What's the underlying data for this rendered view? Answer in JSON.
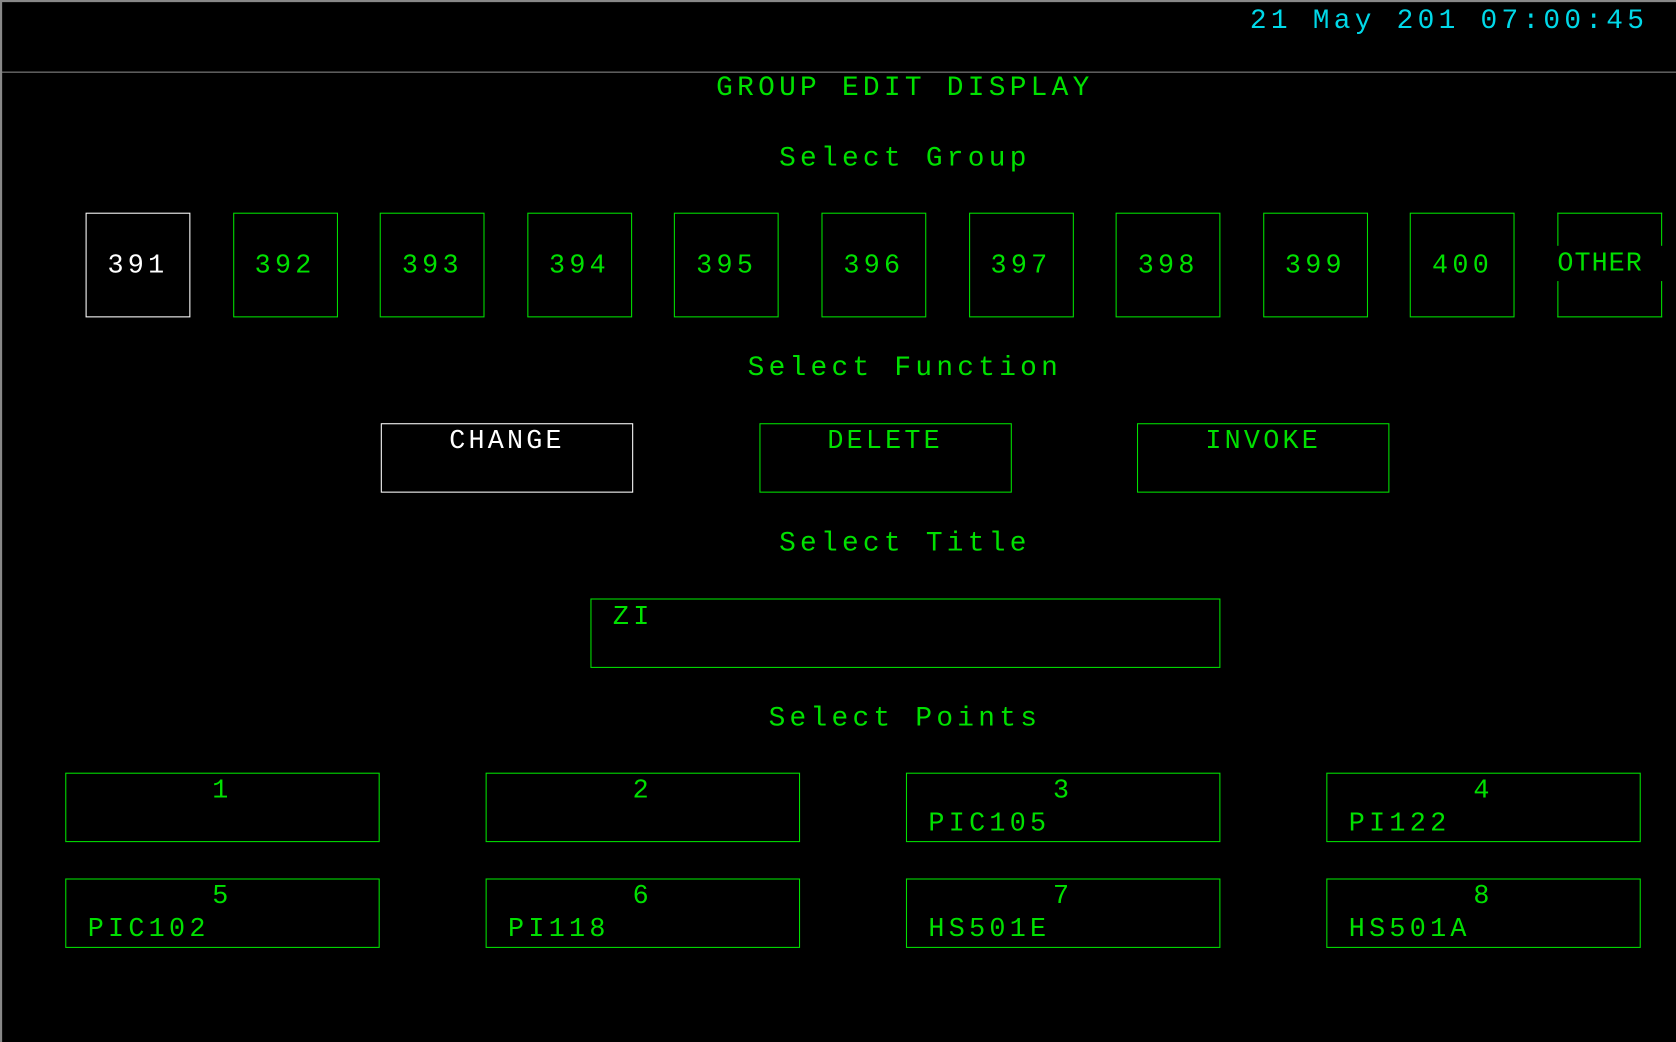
{
  "header": {
    "date": "21 May 201",
    "time": "07:00:45"
  },
  "title": "GROUP EDIT DISPLAY",
  "select_group": {
    "label": "Select Group",
    "groups": [
      "391",
      "392",
      "393",
      "394",
      "395",
      "396",
      "397",
      "398",
      "399",
      "400",
      "OTHER"
    ],
    "selected": "391"
  },
  "select_function": {
    "label": "Select Function",
    "functions": [
      "CHANGE",
      "DELETE",
      "INVOKE"
    ],
    "selected": "CHANGE"
  },
  "select_title": {
    "label": "Select Title",
    "value": "ZI"
  },
  "select_points": {
    "label": "Select Points",
    "points": [
      {
        "num": "1",
        "tag": ""
      },
      {
        "num": "2",
        "tag": ""
      },
      {
        "num": "3",
        "tag": "PIC105"
      },
      {
        "num": "4",
        "tag": "PI122"
      },
      {
        "num": "5",
        "tag": "PIC102"
      },
      {
        "num": "6",
        "tag": "PI118"
      },
      {
        "num": "7",
        "tag": "HS501E"
      },
      {
        "num": "8",
        "tag": "HS501A"
      }
    ]
  },
  "colors": {
    "normal": "#00e000",
    "selected": "#ffffff",
    "clock": "#00d8e8",
    "background": "#000000"
  }
}
